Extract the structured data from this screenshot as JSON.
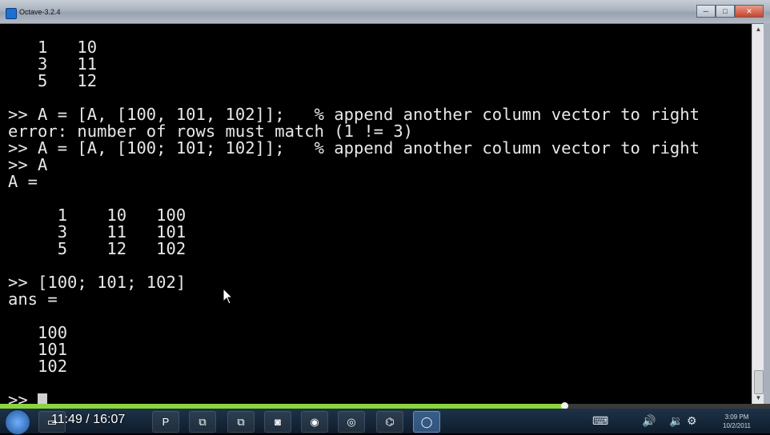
{
  "window": {
    "title": "Octave-3.2.4",
    "minimize_glyph": "─",
    "maximize_glyph": "□",
    "close_glyph": "✕"
  },
  "console": {
    "lines": [
      "   1   10",
      "   3   11",
      "   5   12",
      "",
      ">> A = [A, [100, 101, 102]];   % append another column vector to right",
      "error: number of rows must match (1 != 3)",
      ">> A = [A, [100; 101; 102]];   % append another column vector to right",
      ">> A",
      "A =",
      "",
      "     1    10   100",
      "     3    11   101",
      "     5    12   102",
      "",
      ">> [100; 101; 102]",
      "ans =",
      "",
      "   100",
      "   101",
      "   102",
      "",
      ">> "
    ],
    "prompt": ">> "
  },
  "video": {
    "time_current": "11:49",
    "time_separator": " / ",
    "time_total": "16:07",
    "progress_fraction": 0.733,
    "progress_color": "#8ad43f"
  },
  "taskbar": {
    "items": [
      {
        "icon": "folder-icon",
        "glyph": "▭"
      },
      {
        "icon": "powerpoint-icon",
        "glyph": "P"
      },
      {
        "icon": "network-icon",
        "glyph": "⧉"
      },
      {
        "icon": "network-icon",
        "glyph": "⧉"
      },
      {
        "icon": "camera-icon",
        "glyph": "◙"
      },
      {
        "icon": "chrome-icon",
        "glyph": "◉"
      },
      {
        "icon": "app-icon",
        "glyph": "◎"
      },
      {
        "icon": "python-icon",
        "glyph": "⌬"
      },
      {
        "icon": "octave-icon",
        "glyph": "◯"
      }
    ],
    "tray": {
      "clock_time": "3:09 PM",
      "clock_date": "10/2/2011",
      "icons": [
        "keyboard-icon",
        "volume-icon",
        "volume-icon",
        "settings-icon"
      ]
    }
  }
}
